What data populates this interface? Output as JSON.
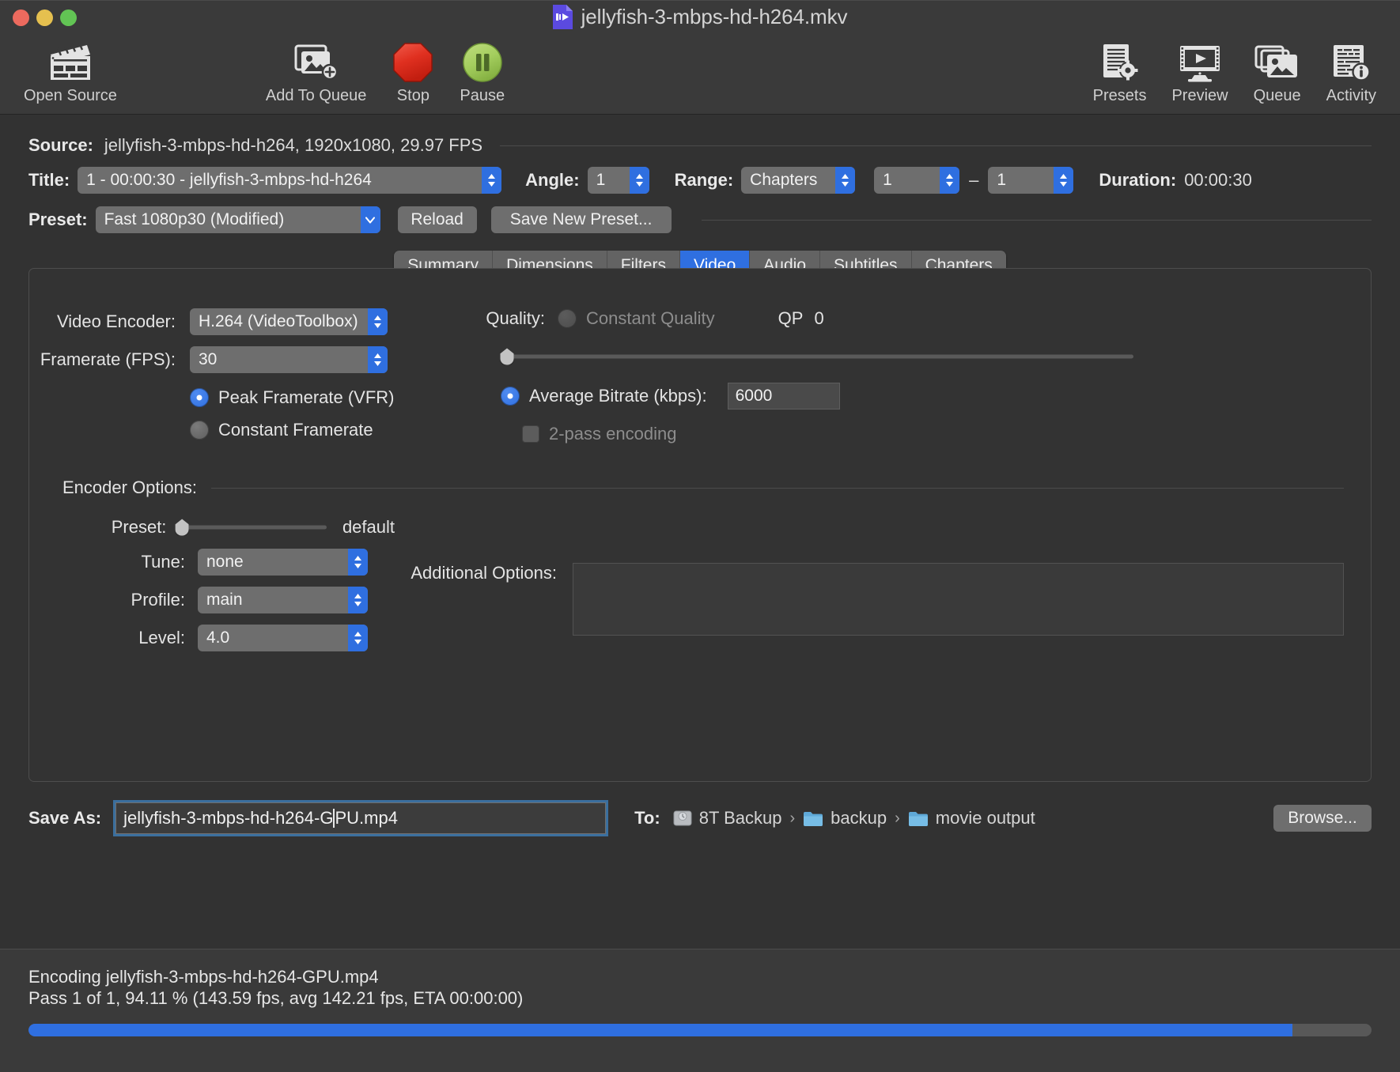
{
  "window": {
    "title": "jellyfish-3-mbps-hd-h264.mkv",
    "traffic_lights": [
      "close",
      "minimize",
      "zoom"
    ]
  },
  "toolbar": {
    "left_items": [
      {
        "label": "Open Source",
        "icon": "clapperboard-icon"
      },
      {
        "label": "Add To Queue",
        "icon": "add-image-icon"
      },
      {
        "label": "Stop",
        "icon": "stop-octagon-icon"
      },
      {
        "label": "Pause",
        "icon": "pause-circle-icon"
      }
    ],
    "right_items": [
      {
        "label": "Presets",
        "icon": "presets-gear-icon"
      },
      {
        "label": "Preview",
        "icon": "monitor-play-icon"
      },
      {
        "label": "Queue",
        "icon": "queue-images-icon"
      },
      {
        "label": "Activity",
        "icon": "activity-log-icon"
      }
    ]
  },
  "source": {
    "label": "Source:",
    "value": "jellyfish-3-mbps-hd-h264, 1920x1080, 29.97 FPS"
  },
  "title_row": {
    "title_label": "Title:",
    "title_value": "1 - 00:00:30 - jellyfish-3-mbps-hd-h264",
    "angle_label": "Angle:",
    "angle_value": "1",
    "range_label": "Range:",
    "range_value": "Chapters",
    "range_start": "1",
    "range_dash": "–",
    "range_end": "1",
    "duration_label": "Duration:",
    "duration_value": "00:00:30"
  },
  "preset_row": {
    "label": "Preset:",
    "value": "Fast 1080p30 (Modified)",
    "reload_label": "Reload",
    "save_new_label": "Save New Preset..."
  },
  "tabs": [
    {
      "label": "Summary",
      "active": false
    },
    {
      "label": "Dimensions",
      "active": false
    },
    {
      "label": "Filters",
      "active": false
    },
    {
      "label": "Video",
      "active": true
    },
    {
      "label": "Audio",
      "active": false
    },
    {
      "label": "Subtitles",
      "active": false
    },
    {
      "label": "Chapters",
      "active": false
    }
  ],
  "video": {
    "encoder_label": "Video Encoder:",
    "encoder_value": "H.264 (VideoToolbox)",
    "framerate_label": "Framerate (FPS):",
    "framerate_value": "30",
    "peak_framerate_label": "Peak Framerate (VFR)",
    "peak_framerate_selected": true,
    "constant_framerate_label": "Constant Framerate",
    "constant_framerate_selected": false,
    "quality_label": "Quality:",
    "constant_quality_label": "Constant Quality",
    "constant_quality_selected": false,
    "qp_label": "QP",
    "qp_value": "0",
    "qp_slider_percent": 1,
    "avg_bitrate_label": "Average Bitrate (kbps):",
    "avg_bitrate_selected": true,
    "avg_bitrate_value": "6000",
    "two_pass_label": "2-pass encoding",
    "two_pass_checked": false,
    "encoder_options_label": "Encoder Options:",
    "enc_preset_label": "Preset:",
    "enc_preset_value": "default",
    "enc_preset_slider_percent": 2,
    "tune_label": "Tune:",
    "tune_value": "none",
    "profile_label": "Profile:",
    "profile_value": "main",
    "level_label": "Level:",
    "level_value": "4.0",
    "additional_options_label": "Additional Options:",
    "additional_options_value": ""
  },
  "save_as": {
    "label": "Save As:",
    "value_before_caret": "jellyfish-3-mbps-hd-h264-G",
    "value_after_caret": "PU.mp4",
    "to_label": "To:",
    "path": [
      {
        "name": "8T Backup",
        "icon": "hard-drive-icon"
      },
      {
        "name": "backup",
        "icon": "folder-icon"
      },
      {
        "name": "movie output",
        "icon": "folder-icon"
      }
    ],
    "separator": "›",
    "browse_label": "Browse..."
  },
  "status": {
    "line1": "Encoding jellyfish-3-mbps-hd-h264-GPU.mp4",
    "line2": "Pass 1 of 1, 94.11 % (143.59 fps, avg 142.21 fps, ETA 00:00:00)",
    "progress_percent": 94.11
  },
  "colors": {
    "accent_blue": "#2f6fe0",
    "window_bg": "#323232",
    "toolbar_bg": "#3a3a3a",
    "control_gray": "#6e6e6e",
    "text": "#e4e4e4"
  }
}
